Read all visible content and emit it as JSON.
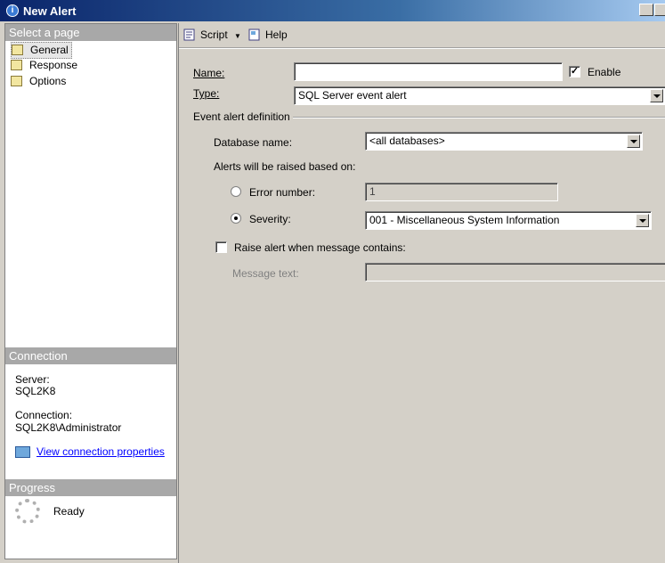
{
  "window": {
    "title": "New Alert",
    "icon": "info-icon"
  },
  "left_panel": {
    "select_page_header": "Select a page",
    "pages": [
      {
        "label": "General",
        "icon": "page-icon",
        "selected": true
      },
      {
        "label": "Response",
        "icon": "page-icon",
        "selected": false
      },
      {
        "label": "Options",
        "icon": "page-icon",
        "selected": false
      }
    ],
    "connection_header": "Connection",
    "server_label": "Server:",
    "server_value": "SQL2K8",
    "connection_label": "Connection:",
    "connection_value": "SQL2K8\\Administrator",
    "view_connection_link": "View connection properties",
    "progress_header": "Progress",
    "progress_status": "Ready"
  },
  "toolbar": {
    "script_label": "Script",
    "help_label": "Help"
  },
  "form": {
    "name_label": "Name:",
    "name_value": "",
    "enable_label": "Enable",
    "enable_checked": true,
    "type_label": "Type:",
    "type_value": "SQL Server event alert",
    "event_group_label": "Event alert definition",
    "database_label": "Database name:",
    "database_value": "<all databases>",
    "raised_label": "Alerts will be raised based on:",
    "error_number_label": "Error number:",
    "error_number_value": "1",
    "severity_label": "Severity:",
    "severity_value": "001 - Miscellaneous System Information",
    "raise_alert_label": "Raise alert when message contains:",
    "raise_alert_checked": false,
    "message_text_label": "Message text:",
    "message_text_value": ""
  }
}
